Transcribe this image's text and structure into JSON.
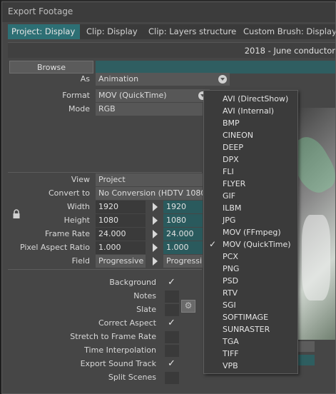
{
  "dialog": {
    "title": "Export Footage",
    "tabs": [
      "Project: Display",
      "Clip: Display",
      "Clip: Layers structure",
      "Custom Brush: Display"
    ],
    "project_name": "2018 - June conductor"
  },
  "browse": {
    "label": "Browse",
    "path": ""
  },
  "as": {
    "label": "As",
    "value": "Animation"
  },
  "format": {
    "label": "Format",
    "value": "MOV (QuickTime)"
  },
  "mode": {
    "label": "Mode",
    "value": "RGB"
  },
  "view": {
    "label": "View",
    "value": "Project"
  },
  "convert_to": {
    "label": "Convert to",
    "value": "No Conversion (HDTV 1080"
  },
  "width": {
    "label": "Width",
    "src": "1920",
    "dst": "1920"
  },
  "height": {
    "label": "Height",
    "src": "1080",
    "dst": "1080"
  },
  "frame_rate": {
    "label": "Frame Rate",
    "src": "24.000",
    "dst": "24.000"
  },
  "pixel_aspect": {
    "label": "Pixel Aspect Ratio",
    "src": "1.000",
    "dst": "1.000"
  },
  "field": {
    "label": "Field",
    "src": "Progressive",
    "dst": "Progressi"
  },
  "options": [
    {
      "label": "Background",
      "checked": true
    },
    {
      "label": "Notes",
      "checked": false
    },
    {
      "label": "Slate",
      "checked": false
    },
    {
      "label": "Correct Aspect",
      "checked": true
    },
    {
      "label": "Stretch to Frame Rate",
      "checked": false
    },
    {
      "label": "Time Interpolation",
      "checked": false
    },
    {
      "label": "Export Sound Track",
      "checked": true
    },
    {
      "label": "Split Scenes",
      "checked": false
    }
  ],
  "format_menu": {
    "items": [
      "AVI (DirectShow)",
      "AVI (Internal)",
      "BMP",
      "CINEON",
      "DEEP",
      "DPX",
      "FLI",
      "FLYER",
      "GIF",
      "ILBM",
      "JPG",
      "MOV (FFmpeg)",
      "MOV (QuickTime)",
      "PCX",
      "PNG",
      "PSD",
      "RTV",
      "SGI",
      "SOFTIMAGE",
      "SUNRASTER",
      "TGA",
      "TIFF",
      "VPB"
    ],
    "selected": "MOV (QuickTime)"
  },
  "check_glyph": "✓",
  "colors": {
    "tab_active": "#2d6f74",
    "teal_field": "#2a5a5d",
    "panel": "#464646"
  }
}
